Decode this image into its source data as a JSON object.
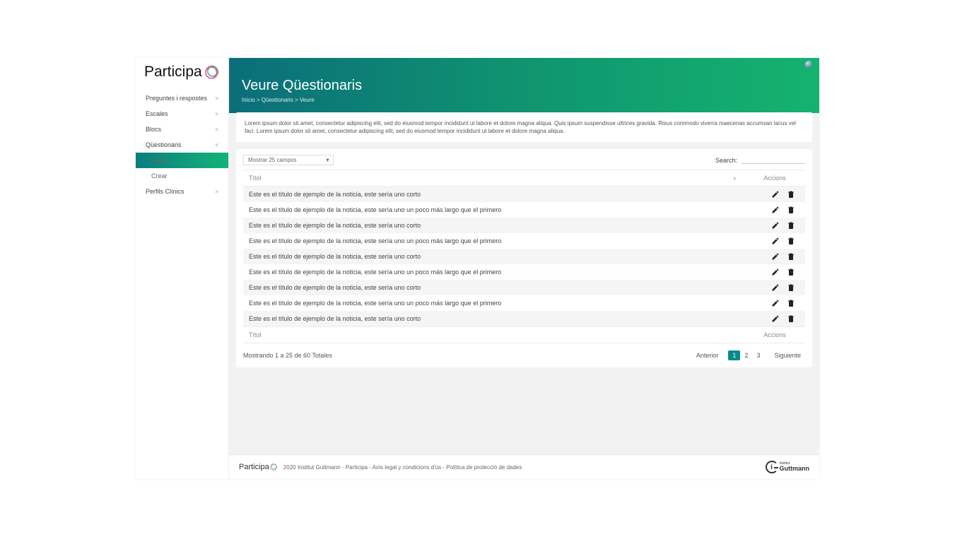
{
  "brand": "Participa",
  "sidebar": {
    "items": [
      {
        "label": "Preguntes i respostes",
        "expandable": true
      },
      {
        "label": "Escales",
        "expandable": true
      },
      {
        "label": "Blocs",
        "expandable": true
      },
      {
        "label": "Qüestionaris",
        "expandable": true,
        "open": true
      },
      {
        "label": "Veure",
        "sub": true,
        "active": true
      },
      {
        "label": "Crear",
        "sub": true
      },
      {
        "label": "Perfils Clínics",
        "expandable": true
      }
    ]
  },
  "page": {
    "title": "Veure Qüestionaris",
    "breadcrumb": "Inicio > Qüestionaris > Veure",
    "description": "Lorem ipsum dolor sit amet, consectetur adipiscing elit, sed do eiusmod tempor incididunt ut labore et dolore magna aliqua. Quis ipsum suspendisse ultrices gravida. Risus commodo viverra maecenas accumsan lacus vel faci. Lorem ipsum dolor sit amet, consectetur adipiscing elit, sed do eiusmod tempor incididunt ut labore et dolore magna aliqua."
  },
  "table": {
    "show_label": "Mostrar 25 campos",
    "search_label": "Search:",
    "th_titol": "Títol",
    "th_accions": "Accions",
    "rows": [
      {
        "title": "Este es el título de ejemplo de la noticia, este sería uno corto"
      },
      {
        "title": "Este es el título de ejemplo de la noticia, este sería uno un poco más largo que el primero"
      },
      {
        "title": "Este es el título de ejemplo de la noticia, este sería uno corto"
      },
      {
        "title": "Este es el título de ejemplo de la noticia, este sería uno un poco más largo que el primero"
      },
      {
        "title": "Este es el título de ejemplo de la noticia, este sería uno corto"
      },
      {
        "title": "Este es el título de ejemplo de la noticia, este sería uno un poco más largo que el primero"
      },
      {
        "title": "Este es el título de ejemplo de la noticia, este sería uno corto"
      },
      {
        "title": "Este es el título de ejemplo de la noticia, este sería uno un poco más largo que el primero"
      },
      {
        "title": "Este es el título de ejemplo de la noticia, este sería uno corto"
      }
    ],
    "info": "Mostrando 1 a 25 de 60 Totales",
    "pager": {
      "prev": "Anterior",
      "pages": [
        "1",
        "2",
        "3"
      ],
      "next": "Siguiente",
      "current": "1"
    }
  },
  "footer": {
    "text": "2020 Institut Guttmann - Participa - Avís legal y condicions d'ús  -  Política de protecció de dades",
    "guttmann_small": "Institut",
    "guttmann_big": "Guttmann"
  }
}
